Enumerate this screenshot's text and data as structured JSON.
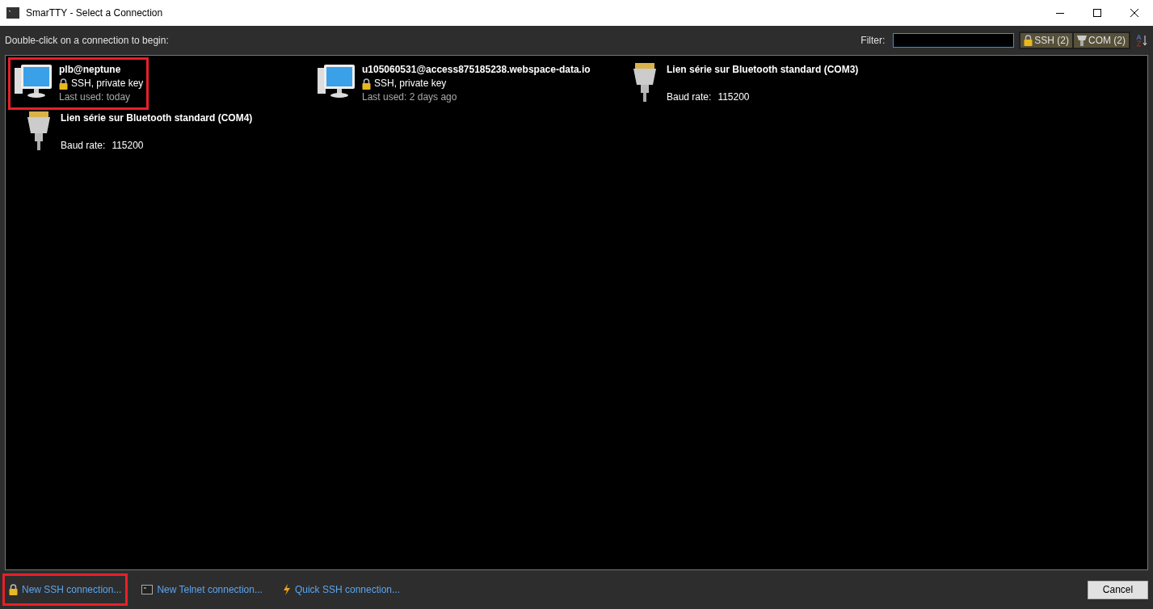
{
  "window": {
    "title": "SmarTTY - Select a Connection"
  },
  "toolbar": {
    "hint": "Double-click on a connection to begin:",
    "filter_label": "Filter:",
    "filters": [
      {
        "kind": "ssh",
        "label": "SSH (2)",
        "on": true
      },
      {
        "kind": "com",
        "label": "COM (2)",
        "on": true
      }
    ]
  },
  "connections": [
    {
      "kind": "ssh",
      "name": "plb@neptune",
      "detail": "SSH, private key",
      "last_used": "Last used: today",
      "highlighted": true
    },
    {
      "kind": "ssh",
      "name": "u105060531@access875185238.webspace-data.io",
      "detail": "SSH, private key",
      "last_used": "Last used: 2 days ago",
      "highlighted": false
    },
    {
      "kind": "com",
      "name": "Lien série sur Bluetooth standard (COM3)",
      "baud_label": "Baud rate:",
      "baud": "115200",
      "highlighted": false
    },
    {
      "kind": "com",
      "name": "Lien série sur Bluetooth standard (COM4)",
      "baud_label": "Baud rate:",
      "baud": "115200",
      "highlighted": false
    }
  ],
  "footer": {
    "links": [
      {
        "kind": "ssh",
        "label": "New SSH connection...",
        "highlighted": true
      },
      {
        "kind": "telnet",
        "label": "New Telnet connection...",
        "highlighted": false
      },
      {
        "kind": "quick",
        "label": "Quick SSH connection...",
        "highlighted": false
      }
    ],
    "cancel": "Cancel"
  }
}
